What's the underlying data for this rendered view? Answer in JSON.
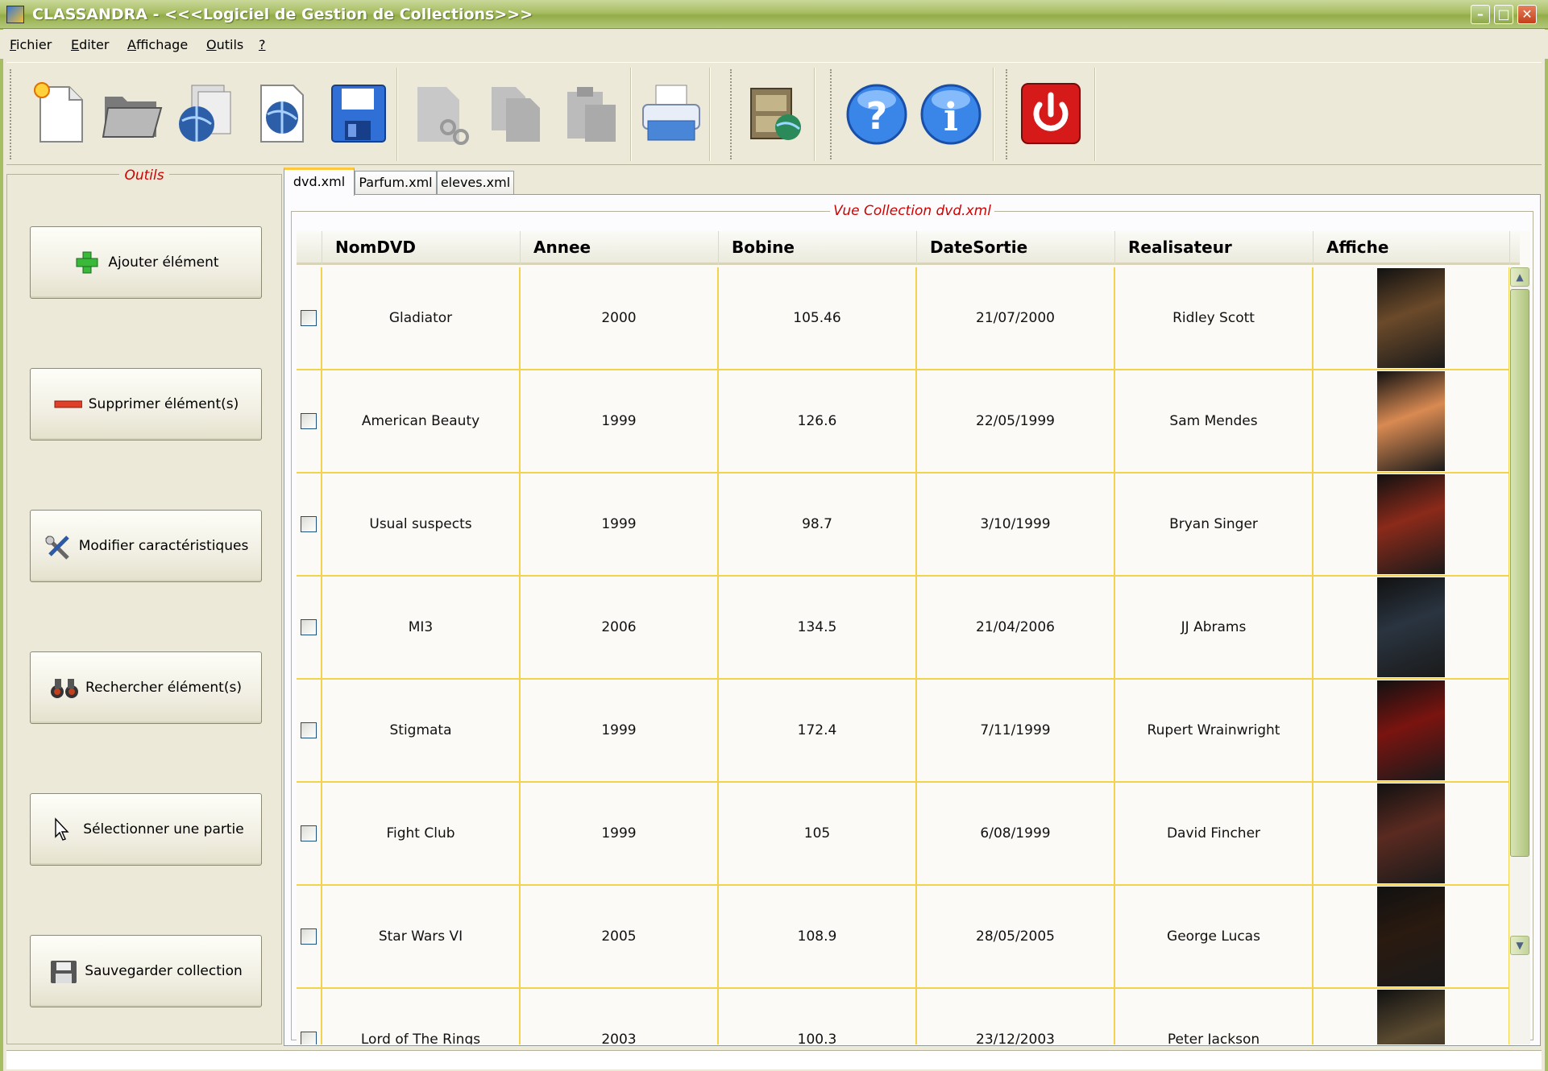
{
  "window": {
    "title": "CLASSANDRA - <<<Logiciel de Gestion de Collections>>>",
    "minimize": "–",
    "maximize": "□",
    "close": "✕"
  },
  "menu": [
    {
      "pre": "",
      "accel": "F",
      "post": "ichier"
    },
    {
      "pre": "",
      "accel": "E",
      "post": "diter"
    },
    {
      "pre": "",
      "accel": "A",
      "post": "ffichage"
    },
    {
      "pre": "",
      "accel": "O",
      "post": "utils"
    },
    {
      "pre": "",
      "accel": "?",
      "post": ""
    }
  ],
  "toolbar": {
    "icons": [
      "new-document-icon",
      "open-folder-icon",
      "open-url-icon",
      "web-document-icon",
      "save-icon",
      "cut-icon",
      "copy-icon",
      "paste-icon",
      "print-icon",
      "network-cabinet-icon",
      "help-icon",
      "info-icon",
      "power-icon"
    ]
  },
  "tools_panel": {
    "legend": "Outils",
    "buttons": [
      {
        "label": "Ajouter élément",
        "icon": "plus-icon"
      },
      {
        "label": "Supprimer élément(s)",
        "icon": "minus-icon"
      },
      {
        "label": "Modifier caractéristiques",
        "icon": "tools-icon"
      },
      {
        "label": "Rechercher élément(s)",
        "icon": "binoculars-icon"
      },
      {
        "label": "Sélectionner une partie",
        "icon": "cursor-icon"
      },
      {
        "label": "Sauvegarder collection",
        "icon": "floppy-icon"
      }
    ]
  },
  "tabs": [
    "dvd.xml",
    "Parfum.xml",
    "eleves.xml"
  ],
  "collection": {
    "legend": "Vue Collection dvd.xml",
    "columns": [
      "NomDVD",
      "Annee",
      "Bobine",
      "DateSortie",
      "Realisateur",
      "Affiche"
    ],
    "rows": [
      {
        "nom": "Gladiator",
        "annee": "2000",
        "bobine": "105.46",
        "date": "21/07/2000",
        "real": "Ridley Scott",
        "poster": "#6b4a2a"
      },
      {
        "nom": "American Beauty",
        "annee": "1999",
        "bobine": "126.6",
        "date": "22/05/1999",
        "real": "Sam Mendes",
        "poster": "#d98a52"
      },
      {
        "nom": "Usual suspects",
        "annee": "1999",
        "bobine": "98.7",
        "date": "3/10/1999",
        "real": "Bryan Singer",
        "poster": "#8b2a1a"
      },
      {
        "nom": "MI3",
        "annee": "2006",
        "bobine": "134.5",
        "date": "21/04/2006",
        "real": "JJ Abrams",
        "poster": "#2a3440"
      },
      {
        "nom": "Stigmata",
        "annee": "1999",
        "bobine": "172.4",
        "date": "7/11/1999",
        "real": "Rupert Wrainwright",
        "poster": "#7a1410"
      },
      {
        "nom": "Fight Club",
        "annee": "1999",
        "bobine": "105",
        "date": "6/08/1999",
        "real": "David Fincher",
        "poster": "#5a2a20"
      },
      {
        "nom": "Star Wars VI",
        "annee": "2005",
        "bobine": "108.9",
        "date": "28/05/2005",
        "real": "George Lucas",
        "poster": "#2a1a10"
      },
      {
        "nom": "Lord of The Rings",
        "annee": "2003",
        "bobine": "100.3",
        "date": "23/12/2003",
        "real": "Peter Jackson",
        "poster": "#5a4a30"
      }
    ]
  }
}
